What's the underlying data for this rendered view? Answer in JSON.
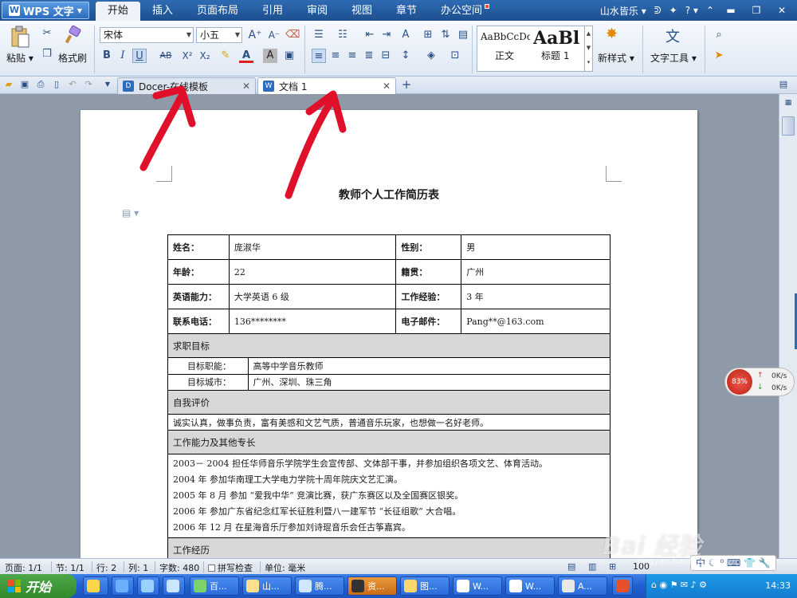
{
  "app": {
    "name": "WPS 文字",
    "logo": "W"
  },
  "menu": {
    "tabs": [
      "开始",
      "插入",
      "页面布局",
      "引用",
      "审阅",
      "视图",
      "章节",
      "办公空间"
    ],
    "active": 0,
    "user": "山水皆乐",
    "help": "?"
  },
  "ribbon": {
    "paste": "粘贴",
    "format_painter": "格式刷",
    "font": "宋体",
    "size": "小五",
    "style_normal_preview": "AaBbCcDd",
    "style_normal": "正文",
    "style_heading_preview": "AaBl",
    "style_heading": "标题 1",
    "new_style": "新样式",
    "text_tools": "文字工具",
    "bold": "B",
    "italic": "I",
    "underline": "U",
    "strike": "AB",
    "superscript": "X²",
    "subscript": "X₂",
    "font_color": "A",
    "char_shade": "A",
    "grow_font": "A⁺",
    "shrink_font": "A⁻"
  },
  "doc_tabs": [
    {
      "title": "Docer-在线模板",
      "active": false
    },
    {
      "title": "文档 1",
      "active": true
    }
  ],
  "resume": {
    "title": "教师个人工作简历表",
    "rows": [
      [
        "姓名：",
        "庞淑华",
        "性别：",
        "男"
      ],
      [
        "年龄：",
        "22",
        "籍贯：",
        "广州"
      ],
      [
        "英语能力：",
        "大学英语 6 级",
        "工作经验：",
        "3 年"
      ],
      [
        "联系电话：",
        "136********",
        "电子邮件：",
        "Pang**@163.com"
      ]
    ],
    "sections": {
      "objective": "求职目标",
      "self_eval": "自我评价",
      "skills": "工作能力及其他专长",
      "experience": "工作经历"
    },
    "objective_items": [
      [
        "目标职能：",
        "高等中学音乐教师"
      ],
      [
        "目标城市：",
        "广州、深圳、珠三角"
      ]
    ],
    "self_eval_text": "诚实认真，做事负责，富有美感和文艺气质，普通音乐玩家，也想做一名好老师。",
    "skills_items": [
      "2003－ 2004 担任华师音乐学院学生会宣传部、文体部干事，并参加组织各项文艺、体育活动。",
      "2004 年  参加华南理工大学电力学院十周年院庆文艺汇演。",
      "2005 年 8 月  参加 “爱我中华” 竞演比赛，获广东赛区以及全国赛区银奖。",
      "2006 年  参加广东省纪念红军长征胜利暨八一建军节 “长征组歌” 大合唱。",
      "2006 年 12 月  在星海音乐厅参加刘诗琨音乐会任古筝嘉宾。"
    ]
  },
  "speed_widget": {
    "percent": "83%",
    "up": "0K/s",
    "down": "0K/s"
  },
  "status": {
    "page": "页面: 1/1",
    "section": "节: 1/1",
    "row": "行: 2",
    "col": "列: 1",
    "words": "字数: 480",
    "spell": "拼写检查",
    "unit": "单位: 毫米",
    "zoom": "100"
  },
  "taskbar": {
    "start": "开始",
    "items": [
      "百...",
      "山...",
      "腾...",
      "资...",
      "图...",
      "W...",
      "W...",
      "A..."
    ],
    "ime": "中",
    "clock": "14:33"
  },
  "watermark": {
    "text": "Bai 经验",
    "url": "jingyan.baidu.com"
  },
  "colors": {
    "title_bar": "#1d4f8f",
    "accent": "#2c6cc0",
    "arrow": "#e0102a"
  }
}
